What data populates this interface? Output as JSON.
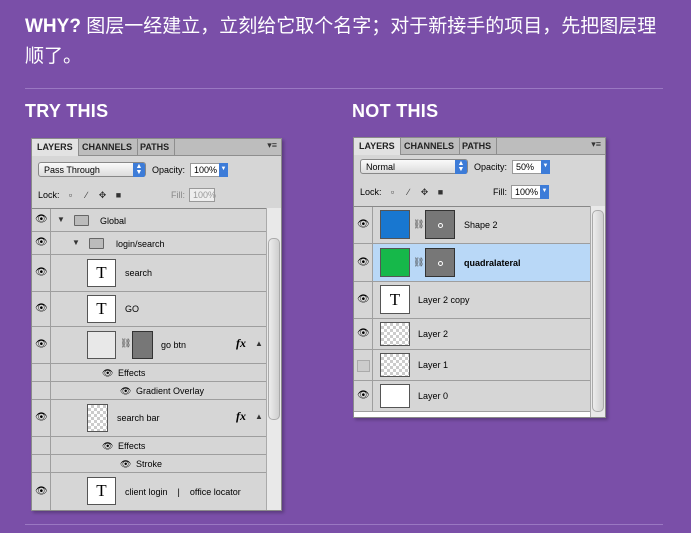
{
  "intro": {
    "why": "WHY?",
    "text": "图层一经建立，立刻给它取个名字；对于新接手的项目，先把图层理顺了。"
  },
  "headings": {
    "try": "TRY THIS",
    "not": "NOT THIS"
  },
  "colors": {
    "background": "#7a4fa8",
    "selected_row": "#b9d8f7",
    "blue_layer": "#1877d0",
    "green_layer": "#16b84a"
  },
  "try_panel": {
    "tabs": [
      "LAYERS",
      "CHANNELS",
      "PATHS"
    ],
    "blend_mode": "Pass Through",
    "opacity_label": "Opacity:",
    "opacity": "100%",
    "lock_label": "Lock:",
    "fill_label": "Fill:",
    "fill": "100%",
    "rows": {
      "global": "Global",
      "login_search": "login/search",
      "search": "search",
      "go": "GO",
      "go_btn": "go btn",
      "effects1": "Effects",
      "gradient_overlay": "Gradient Overlay",
      "search_bar": "search bar",
      "effects2": "Effects",
      "stroke": "Stroke",
      "client_login": "client login    |    office locator"
    },
    "fx": "fx",
    "text_thumb": "T"
  },
  "not_panel": {
    "tabs": [
      "LAYERS",
      "CHANNELS",
      "PATHS"
    ],
    "blend_mode": "Normal",
    "opacity_label": "Opacity:",
    "opacity": "50%",
    "lock_label": "Lock:",
    "fill_label": "Fill:",
    "fill": "100%",
    "rows": {
      "shape2": "Shape 2",
      "quadralateral": "quadralateral",
      "layer2copy": "Layer 2 copy",
      "layer2": "Layer 2",
      "layer1": "Layer 1",
      "layer0": "Layer 0"
    },
    "text_thumb": "T"
  }
}
